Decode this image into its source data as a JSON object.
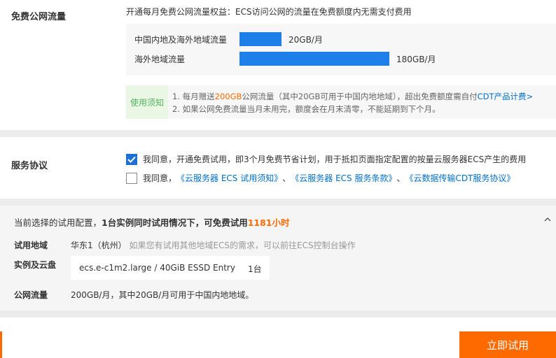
{
  "traffic": {
    "title": "免费公网流量",
    "description": "开通每月免费公网流量权益：ECS访问公网的流量在免费额度内无需支付费用",
    "quotas": [
      {
        "label": "中国内地及海外地域流量",
        "value": "20GB/月",
        "amount_gb": 20
      },
      {
        "label": "海外地域流量",
        "value": "180GB/月",
        "amount_gb": 180
      }
    ],
    "notice_tag": "使用须知",
    "notice_line1_a": "1. 每月赠送",
    "notice_line1_highlight": "200GB",
    "notice_line1_b": "公网流量（其中20GB可用于中国内地地域），超出免费额度需自付",
    "notice_line1_link": "CDT产品计费>",
    "notice_line2": "2. 如果公网免费流量当月未用完，额度会在月末清零，不能延期到下个月。"
  },
  "agreement": {
    "title": "服务协议",
    "checkbox1_checked": true,
    "checkbox1_text": "我同意，开通免费试用，即3个月免费节省计划，用于抵扣页面指定配置的按量云服务器ECS产生的费用",
    "checkbox2_checked": false,
    "checkbox2_prefix": "我同意，",
    "links": [
      "《云服务器 ECS 试用须知》",
      "《云服务器 ECS 服务条款》",
      "《云数据传输CDT服务协议》"
    ],
    "link_separator": "、"
  },
  "summary": {
    "head_prefix": "当前选择的试用配置，",
    "head_bold": "1台实例同时试用情况下，可免费试用",
    "head_hours": "1181小时",
    "region_label": "试用地域",
    "region_value": "华东1（杭州）",
    "region_hint": "如果您有试用其他地域ECS的需求，可以前往ECS控制台操作",
    "instance_label": "实例及云盘",
    "instance_spec": "ecs.e-c1m2.large / 40GiB ESSD Entry",
    "instance_count": "1台",
    "traffic_label": "公网流量",
    "traffic_value": "200GB/月，其中20GB/月可用于中国内地地域。"
  },
  "footer": {
    "try_button": "立即试用"
  },
  "colors": {
    "accent": "#ff6a00",
    "bar": "#1e7fe8",
    "link": "#0070cc",
    "notice_green": "#52b35d"
  }
}
